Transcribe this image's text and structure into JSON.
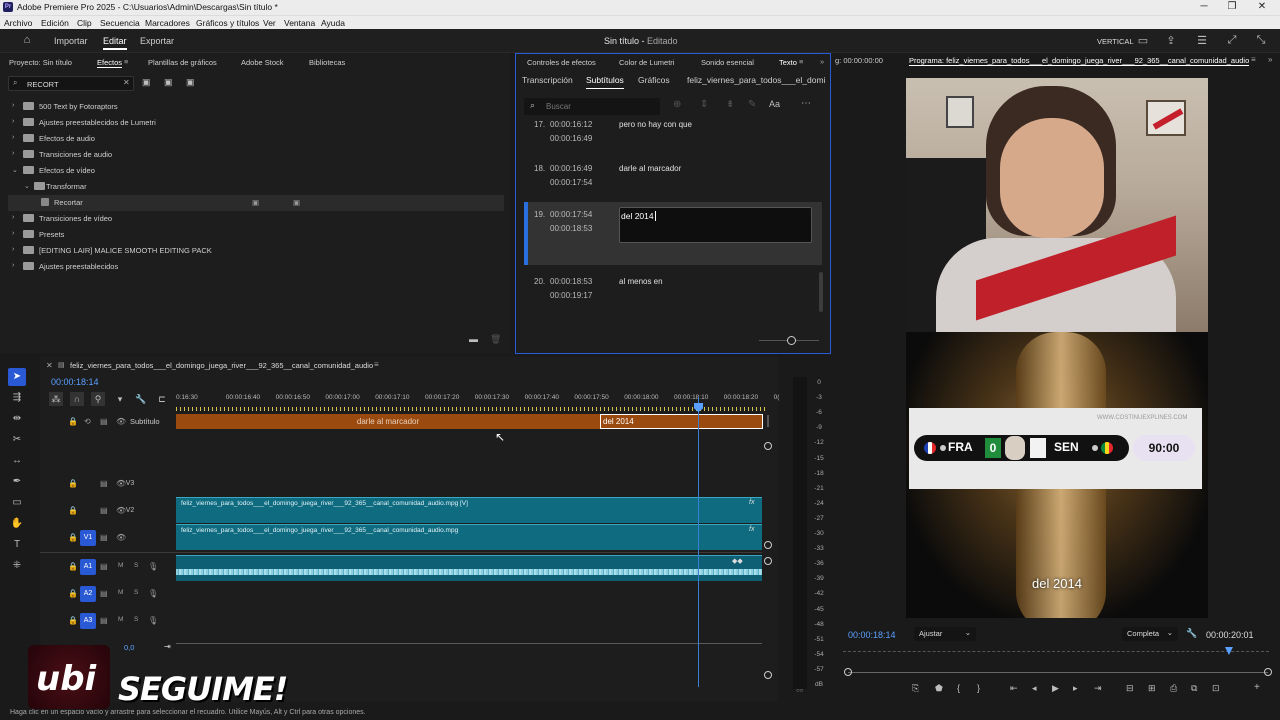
{
  "window": {
    "app_icon": "Pr",
    "title": "Adobe Premiere Pro 2025 - C:\\Usuarios\\Admin\\Descargas\\Sin título *",
    "controls": [
      "─",
      "❐",
      "✕"
    ]
  },
  "menu": [
    "Archivo",
    "Edición",
    "Clip",
    "Secuencia",
    "Marcadores",
    "Gráficos y títulos",
    "Ver",
    "Ventana",
    "Ayuda"
  ],
  "header": {
    "nav": [
      "Importar",
      "Editar",
      "Exportar"
    ],
    "active_nav": "Editar",
    "project_title": "Sin título",
    "project_status": "Editado",
    "workspace": "VERTICAL"
  },
  "effects_panel": {
    "tabs": [
      "Proyecto: Sin título",
      "Efectos",
      "Plantillas de gráficos",
      "Adobe Stock",
      "Bibliotecas"
    ],
    "search_value": "RECORT",
    "tree": [
      {
        "label": "500 Text by Fotoraptors",
        "level": 0
      },
      {
        "label": "Ajustes preestablecidos de Lumetri",
        "level": 0
      },
      {
        "label": "Efectos de audio",
        "level": 0
      },
      {
        "label": "Transiciones de audio",
        "level": 0
      },
      {
        "label": "Efectos de vídeo",
        "level": 0,
        "open": true
      },
      {
        "label": "Transformar",
        "level": 1,
        "open": true
      },
      {
        "label": "Recortar",
        "level": 2,
        "selected": true
      },
      {
        "label": "Transiciones de vídeo",
        "level": 0
      },
      {
        "label": "Presets",
        "level": 0
      },
      {
        "label": "[EDITING LAIR] MALICE SMOOTH EDITING PACK",
        "level": 0
      },
      {
        "label": "Ajustes preestablecidos",
        "level": 0
      }
    ]
  },
  "captions_panel": {
    "top_tabs": [
      "Controles de efectos",
      "Color de Lumetri",
      "Sonido esencial",
      "Texto"
    ],
    "sub_tabs": [
      "Transcripción",
      "Subtítulos",
      "Gráficos",
      "feliz_viernes_para_todos___el_domi"
    ],
    "search_placeholder": "Buscar",
    "captions": [
      {
        "num": "17.",
        "start": "00:00:16:12",
        "end": "00:00:16:49",
        "text": "pero no hay con que"
      },
      {
        "num": "18.",
        "start": "00:00:16:49",
        "end": "00:00:17:54",
        "text": "darle al marcador"
      },
      {
        "num": "19.",
        "start": "00:00:17:54",
        "end": "00:00:18:53",
        "text": "del 2014",
        "editing": true
      },
      {
        "num": "20.",
        "start": "00:00:18:53",
        "end": "00:00:19:17",
        "text": "al menos en"
      }
    ]
  },
  "source_panel": {
    "timecode": "g: 00:00:00:00"
  },
  "program_monitor": {
    "title": "Programa: feliz_viernes_para_todos___el_domingo_juega_river___92_365__canal_comunidad_audio",
    "scoreboard": {
      "team1": "FRA",
      "score1": "0",
      "team2": "SEN",
      "time": "90:00"
    },
    "watermark": "WWW.COSTINUEXPLINES.COM",
    "caption_overlay": "del 2014",
    "current_tc": "00:00:18:14",
    "fit": "Ajustar",
    "quality": "Completa",
    "duration_tc": "00:00:20:01",
    "playhead_fraction": 0.906
  },
  "timeline": {
    "sequence_name": "feliz_viernes_para_todos___el_domingo_juega_river___92_365__canal_comunidad_audio",
    "current_tc": "00:00:18:14",
    "ruler_labels": [
      "0:16:30",
      "00:00:16:40",
      "00:00:16:50",
      "00:00:17:00",
      "00:00:17:10",
      "00:00:17:20",
      "00:00:17:30",
      "00:00:17:40",
      "00:00:17:50",
      "00:00:18:00",
      "00:00:18:10",
      "00:00:18:20",
      "0("
    ],
    "subtitle_track": "Subtítulo",
    "subtitle_clips": [
      "darle al marcador",
      "del 2014"
    ],
    "video_tracks": [
      "V3",
      "V2",
      "V1"
    ],
    "audio_tracks": [
      "A1",
      "A2",
      "A3"
    ],
    "clip_v2": "feliz_viernes_para_todos___el_domingo_juega_river___92_365__canal_comunidad_audio.mpg [V]",
    "clip_v1": "feliz_viernes_para_todos___el_domingo_juega_river___92_365__canal_comunidad_audio.mpg",
    "master_level": "0,0",
    "track_buttons": [
      "M",
      "S"
    ],
    "fx_badge": "fx"
  },
  "vu_meter": {
    "labels": [
      "0",
      "-3",
      "-6",
      "-9",
      "-12",
      "-15",
      "-18",
      "-21",
      "-24",
      "-27",
      "-30",
      "-33",
      "-36",
      "-39",
      "-42",
      "-45",
      "-48",
      "-51",
      "-54",
      "-57",
      "dB"
    ]
  },
  "status_bar": {
    "text": "Haga clic en un espacio vacío y arrastre para seleccionar el recuadro. Utilice Mayús, Alt y Ctrl para otras opciones.",
    "overlay_brand": "ubi",
    "overlay_text": "SEGUIME!"
  },
  "colors": {
    "accent": "#2a59d6",
    "subtitle_clip": "#9a4a0e",
    "video_clip": "#0f6b80",
    "audio_clip": "#0e5f73"
  }
}
